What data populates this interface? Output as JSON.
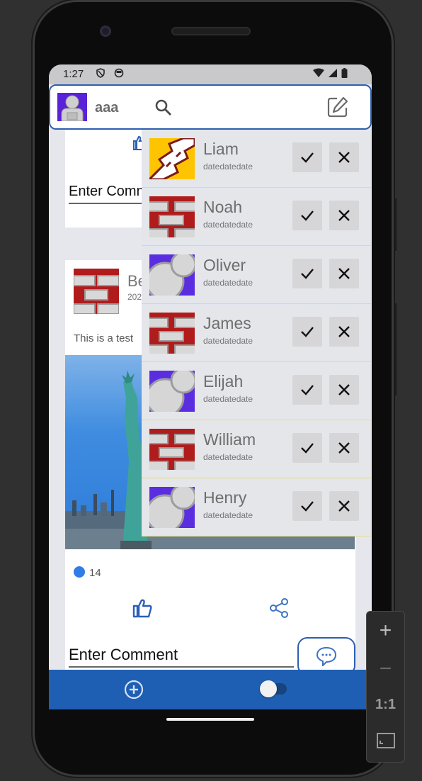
{
  "status_bar": {
    "time": "1:27"
  },
  "top_bar": {
    "username": "aaa"
  },
  "feed": {
    "card1": {
      "comment_placeholder": "Enter Comm"
    },
    "card2": {
      "poster_name": "Be",
      "date": "202",
      "body": "This is a test",
      "like_count": "14",
      "comment_placeholder": "Enter Comment"
    }
  },
  "requests": [
    {
      "name": "Liam",
      "date": "datedatedate",
      "avatar": "yellow-pattern"
    },
    {
      "name": "Noah",
      "date": "datedatedate",
      "avatar": "red-brick"
    },
    {
      "name": "Oliver",
      "date": "datedatedate",
      "avatar": "purple-circles"
    },
    {
      "name": "James",
      "date": "datedatedate",
      "avatar": "red-brick"
    },
    {
      "name": "Elijah",
      "date": "datedatedate",
      "avatar": "purple-circles"
    },
    {
      "name": "William",
      "date": "datedatedate",
      "avatar": "red-brick"
    },
    {
      "name": "Henry",
      "date": "datedatedate",
      "avatar": "purple-circles"
    }
  ],
  "emulator_controls": {
    "zoom_in": "+",
    "zoom_out": "−",
    "one_to_one": "1:1"
  },
  "colors": {
    "accent": "#1f5fb3",
    "list_bg": "#e5e6ea",
    "divider": "#e2dd86"
  }
}
